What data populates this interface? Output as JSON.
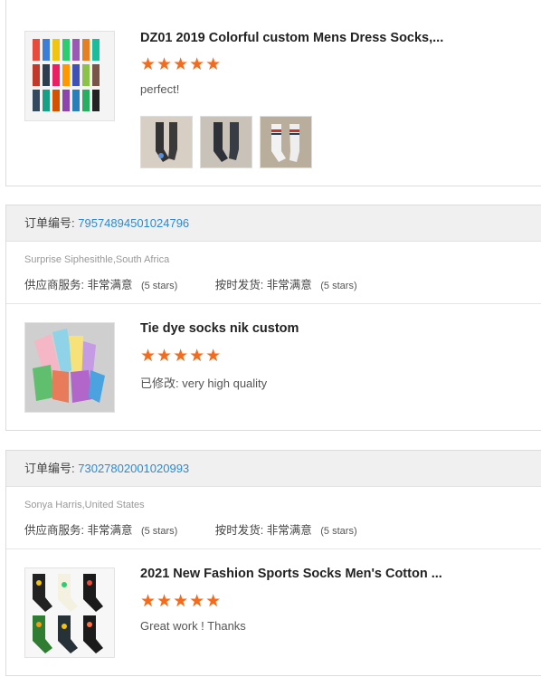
{
  "reviews": [
    {
      "product_title": "DZ01 2019 Colorful custom Mens Dress Socks,...",
      "rating": 5,
      "stars": "★★★★★",
      "comment": "perfect!",
      "photo_count": 3
    },
    {
      "order_label": "订单编号:",
      "order_number": "79574894501024796",
      "buyer": "Surprise Siphesithle,South Africa",
      "supplier_service_label": "供应商服务:",
      "supplier_service_value": "非常满意",
      "supplier_service_stars": "(5 stars)",
      "on_time_label": "按时发货:",
      "on_time_value": "非常满意",
      "on_time_stars": "(5 stars)",
      "product_title": "Tie dye socks nik custom",
      "rating": 5,
      "stars": "★★★★★",
      "comment": "已修改: very high quality"
    },
    {
      "order_label": "订单编号:",
      "order_number": "73027802001020993",
      "buyer": "Sonya Harris,United States",
      "supplier_service_label": "供应商服务:",
      "supplier_service_value": "非常满意",
      "supplier_service_stars": "(5 stars)",
      "on_time_label": "按时发货:",
      "on_time_value": "非常满意",
      "on_time_stars": "(5 stars)",
      "product_title": "2021 New Fashion Sports Socks Men's Cotton ...",
      "rating": 5,
      "stars": "★★★★★",
      "comment": "Great work ! Thanks"
    }
  ],
  "colors": {
    "star": "#f36b1c",
    "order_link": "#2d8bcd",
    "header_bg": "#f0f0f0"
  }
}
